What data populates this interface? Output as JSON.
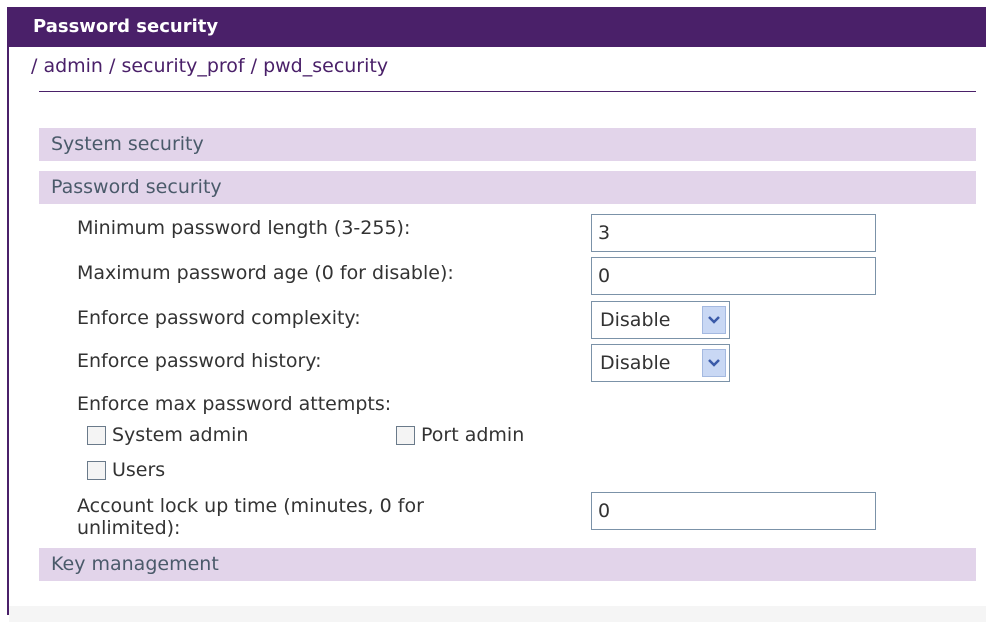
{
  "window": {
    "title": "Password security"
  },
  "breadcrumb": {
    "text": "/ admin / security_prof / pwd_security"
  },
  "sections": {
    "system_security": "System security",
    "password_security": "Password security",
    "key_management": "Key management"
  },
  "form": {
    "min_length": {
      "label": "Minimum password length (3-255):",
      "value": "3"
    },
    "max_age": {
      "label": "Maximum password age (0 for disable):",
      "value": "0"
    },
    "complexity": {
      "label": "Enforce password complexity:",
      "value": "Disable"
    },
    "history": {
      "label": "Enforce password history:",
      "value": "Disable"
    },
    "max_attempts": {
      "label": "Enforce max password attempts:",
      "system_admin": {
        "label": "System admin",
        "checked": false
      },
      "port_admin": {
        "label": "Port admin",
        "checked": false
      },
      "users": {
        "label": "Users",
        "checked": false
      }
    },
    "lock_time": {
      "label_line1": "Account lock up time (minutes, 0 for",
      "label_line2": "unlimited):",
      "value": "0"
    }
  },
  "colors": {
    "header": "#4a2069",
    "section_bg": "#e2d4ea",
    "section_text": "#4a5a6a"
  },
  "icons": {
    "dropdown": "chevron-down-icon"
  }
}
